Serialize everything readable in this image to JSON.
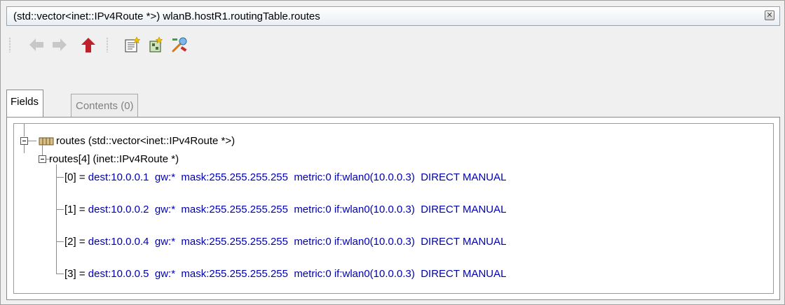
{
  "window": {
    "title": "(std::vector<inet::IPv4Route *>) wlanB.hostR1.routingTable.routes",
    "close_glyph": "✕"
  },
  "toolbar": {
    "buttons": [
      {
        "name": "back-arrow-icon",
        "enabled": false
      },
      {
        "name": "forward-arrow-icon",
        "enabled": false
      },
      {
        "name": "up-arrow-icon",
        "enabled": true
      },
      {
        "name": "inspect-icon",
        "enabled": true
      },
      {
        "name": "inspect-network-icon",
        "enabled": true
      },
      {
        "name": "tools-icon",
        "enabled": true
      }
    ]
  },
  "tabs": [
    {
      "label": "Fields",
      "active": true
    },
    {
      "label": "Contents (0)",
      "active": false
    }
  ],
  "tree": {
    "root": {
      "label": "routes (std::vector<inet::IPv4Route *>)",
      "icon": "vector-icon"
    },
    "child": {
      "label": "routes[4] (inet::IPv4Route *)"
    },
    "items": [
      {
        "index": "[0] = ",
        "value": "dest:10.0.0.1  gw:*  mask:255.255.255.255  metric:0 if:wlan0(10.0.0.3)  DIRECT MANUAL"
      },
      {
        "index": "[1] = ",
        "value": "dest:10.0.0.2  gw:*  mask:255.255.255.255  metric:0 if:wlan0(10.0.0.3)  DIRECT MANUAL"
      },
      {
        "index": "[2] = ",
        "value": "dest:10.0.0.4  gw:*  mask:255.255.255.255  metric:0 if:wlan0(10.0.0.3)  DIRECT MANUAL"
      },
      {
        "index": "[3] = ",
        "value": "dest:10.0.0.5  gw:*  mask:255.255.255.255  metric:0 if:wlan0(10.0.0.3)  DIRECT MANUAL"
      }
    ]
  },
  "colors": {
    "value_text": "#0000b4",
    "disabled_arrow": "#c8c8c8",
    "up_arrow": "#c0202a"
  }
}
